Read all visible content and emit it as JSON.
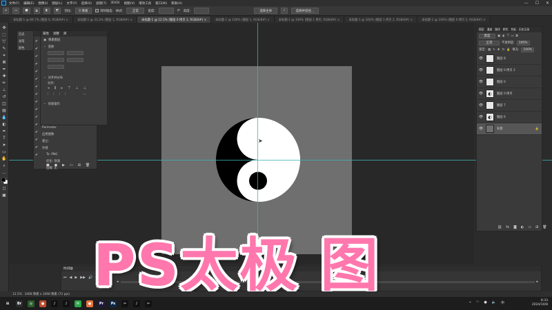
{
  "menu": {
    "items": [
      "文件(F)",
      "编辑(E)",
      "图像(I)",
      "图层(L)",
      "文字(Y)",
      "选择(S)",
      "滤镜(T)",
      "3D(D)",
      "视图(V)",
      "增效工具",
      "窗口(W)",
      "帮助(H)"
    ],
    "window_controls": [
      "—",
      "☐",
      "✕"
    ]
  },
  "options": {
    "mode_label": "新选区",
    "feather_label": "羽化:",
    "feather_value": "0 像素",
    "antialias_label": "消除锯齿",
    "style_label": "样式:",
    "style_value": "正常",
    "width_label": "宽度:",
    "height_label": "高度:",
    "select_subject": "选择主体",
    "select_mask": "选择并遮住..."
  },
  "tabs": [
    {
      "label": "未标题-1 @ 66.7% (图层 0, RGB/8#) ×",
      "active": false
    },
    {
      "label": "未标题-1 @ 33.3% (图层 1, RGB/8#) ×",
      "active": false
    },
    {
      "label": "未标题-1 @ 12.5% (图层 0 拷贝 2, RGB/8#) ×",
      "active": true
    },
    {
      "label": "未标题-1 @ 100% (图层 1, RGB/8#) ×",
      "active": false
    },
    {
      "label": "未标题-1 @ 100% (图层 1 拷贝, RGB/8#) ×",
      "active": false
    },
    {
      "label": "未标题-1 @ 100% (图层 1 拷贝 2, RGB/8#) ×",
      "active": false
    },
    {
      "label": "未标题-1 @ 100% (图层 0 拷贝 2, RGB/8#) ×",
      "active": false
    }
  ],
  "properties_panel": {
    "tabs": [
      "属性",
      "调整",
      "库"
    ],
    "header": "像素图层",
    "section_transform": "变换",
    "section_align": "对齐并分布",
    "align_label": "对齐:",
    "section_quick": "快速操作"
  },
  "left_panel": {
    "items": [
      "历史",
      "画笔",
      "颜色"
    ],
    "history": [
      "Perimeter",
      "应用图像",
      "建立:",
      "存储",
      "添加图层",
      "删除图层"
    ],
    "sublist": [
      "To: PNG",
      "优化: 快速",
      "压缩: 无"
    ]
  },
  "layers_panel": {
    "tabs": [
      "图层",
      "通道",
      "路径",
      "颜色",
      "色板",
      "历史记录"
    ],
    "filter_label": "类型",
    "blend_label": "正常",
    "opacity_label": "不透明度:",
    "opacity_value": "100%",
    "lock_label": "锁定:",
    "fill_label": "填充:",
    "fill_value": "100%",
    "layers": [
      {
        "name": "图层 8",
        "selected": false
      },
      {
        "name": "图层 0 拷贝 2",
        "selected": false
      },
      {
        "name": "图层 0",
        "selected": false
      },
      {
        "name": "图层 0 拷贝",
        "selected": false
      },
      {
        "name": "图层 7",
        "selected": false
      },
      {
        "name": "图层 6",
        "selected": false
      },
      {
        "name": "背景",
        "selected": true
      }
    ]
  },
  "timeline": {
    "title": "时间轴",
    "scroll_left": "◂",
    "scroll_right": "▸"
  },
  "status": {
    "zoom": "12.5%",
    "doc_info": "3468 像素 x 3468 像素 (72 ppi)"
  },
  "title_overlay": "PS太极 图",
  "clock": {
    "time": "8:33",
    "date": "2024/10/8"
  },
  "taskbar": {
    "apps": [
      {
        "label": "⊞",
        "color": "#1d1d1d"
      },
      {
        "label": "Br",
        "color": "#2b2b2b"
      },
      {
        "label": "◎",
        "color": "#2b5b2b"
      },
      {
        "label": "●",
        "color": "#c04b2f"
      },
      {
        "label": "♪",
        "color": "#111111"
      },
      {
        "label": "♪",
        "color": "#111111"
      },
      {
        "label": "✉",
        "color": "#2ca74b"
      },
      {
        "label": "●",
        "color": "#e8733c"
      },
      {
        "label": "Pr",
        "color": "#1e1a3c"
      },
      {
        "label": "Ps",
        "color": "#0c2a48"
      },
      {
        "label": "✂",
        "color": "#111111"
      },
      {
        "label": "♪",
        "color": "#111111"
      },
      {
        "label": "✂",
        "color": "#111111"
      }
    ]
  },
  "colors": {
    "accent": "#ff77ad",
    "guide": "#3fb3b3",
    "ps_blue": "#31a8ff"
  }
}
